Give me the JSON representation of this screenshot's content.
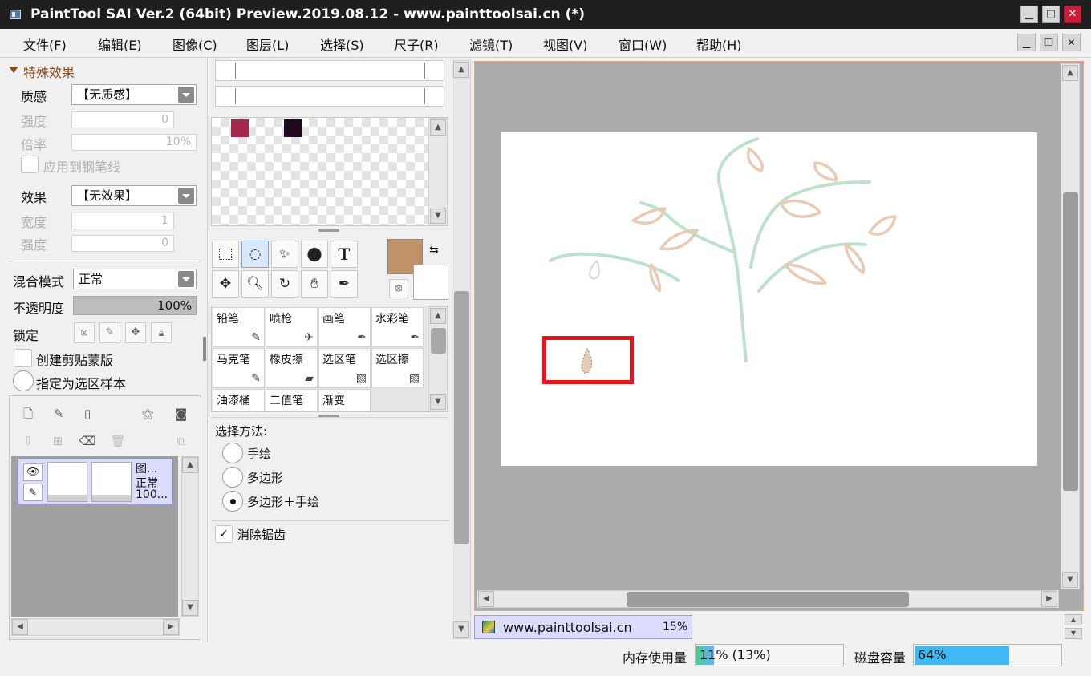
{
  "window": {
    "title": "PaintTool SAI Ver.2 (64bit) Preview.2019.08.12 - www.painttoolsai.cn (*)",
    "minimize": "▁",
    "maximize": "□",
    "close": "✕"
  },
  "menu": [
    "文件(F)",
    "编辑(E)",
    "图像(C)",
    "图层(L)",
    "选择(S)",
    "尺子(R)",
    "滤镜(T)",
    "视图(V)",
    "窗口(W)",
    "帮助(H)"
  ],
  "mdi": {
    "min": "▁",
    "restore": "❐",
    "close": "✕"
  },
  "effects": {
    "header": "特殊效果",
    "texture_label": "质感",
    "texture_value": "【无质感】",
    "strength_label": "强度",
    "strength_value": "0",
    "scale_label": "倍率",
    "scale_value": "10%",
    "apply_pen": "应用到钢笔线",
    "effect_label": "效果",
    "effect_value": "【无效果】",
    "width_label": "宽度",
    "width_value": "1",
    "strength2_label": "强度",
    "strength2_value": "0"
  },
  "layer_props": {
    "blend_label": "混合模式",
    "blend_value": "正常",
    "opacity_label": "不透明度",
    "opacity_value": "100%",
    "opacity_fraction": 1.0,
    "lock_label": "锁定",
    "clip_label": "创建剪贴蒙版",
    "sample_label": "指定为选区样本"
  },
  "layer": {
    "name": "图...",
    "mode": "正常",
    "opacity": "100..."
  },
  "palette": {
    "swatches": [
      "#a4284e",
      "#1e0a1c"
    ],
    "main_color": "#bf9267",
    "sub_color": "#ffffff"
  },
  "tools": {
    "text_tool": "T"
  },
  "brushes": [
    {
      "name": "铅笔",
      "icon": "✎"
    },
    {
      "name": "喷枪",
      "icon": "✈"
    },
    {
      "name": "画笔",
      "icon": "✒"
    },
    {
      "name": "水彩笔",
      "icon": "✒"
    },
    {
      "name": "马克笔",
      "icon": "✎"
    },
    {
      "name": "橡皮擦",
      "icon": "▰"
    },
    {
      "name": "选区笔",
      "icon": "▧"
    },
    {
      "name": "选区擦",
      "icon": "▧"
    },
    {
      "name": "油漆桶",
      "icon": ""
    },
    {
      "name": "二值笔",
      "icon": ""
    },
    {
      "name": "渐变",
      "icon": ""
    }
  ],
  "selection": {
    "method_label": "选择方法:",
    "options": [
      "手绘",
      "多边形",
      "多边形＋手绘"
    ],
    "selected_index": 2,
    "antialias_label": "消除锯齿",
    "antialias_checked": "✓"
  },
  "canvas_tab": {
    "name": "www.painttoolsai.cn",
    "zoom": "15%"
  },
  "status": {
    "memory_label": "内存使用量",
    "memory_value": "11% (13%)",
    "memory_fraction": 0.11,
    "disk_label": "磁盘容量",
    "disk_value": "64%",
    "disk_fraction": 0.64
  },
  "colors": {
    "accent_frame": "#e9a37a",
    "highlight_box": "#e8141e",
    "branch": "#bfe0cc",
    "leaf": "#e8cbb7"
  }
}
